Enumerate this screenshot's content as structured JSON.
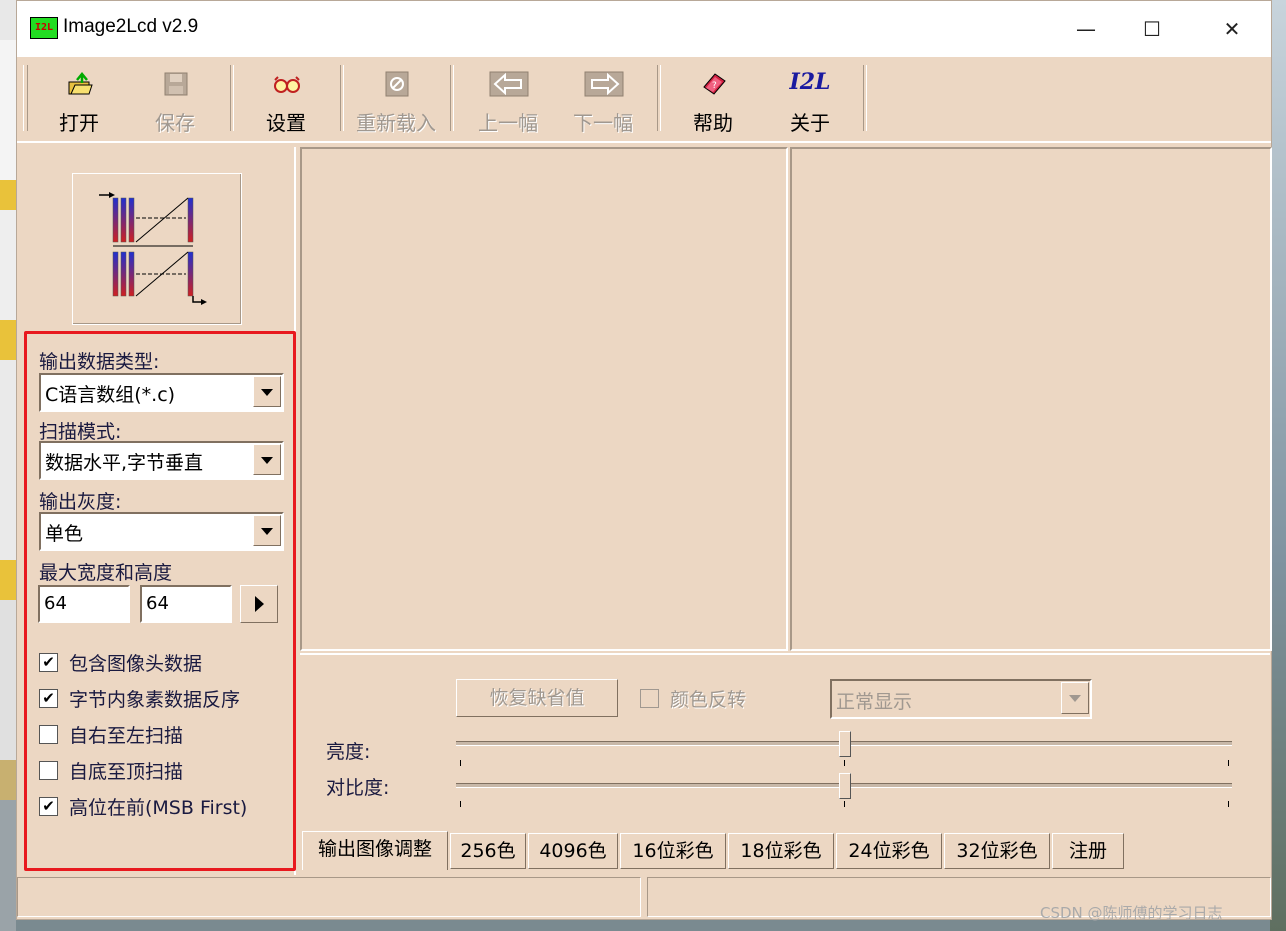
{
  "window": {
    "app_icon_text": "I2L",
    "title": "Image2Lcd v2.9",
    "controls": [
      "—",
      "☐",
      "✕"
    ]
  },
  "toolbar": {
    "open": "打开",
    "save": "保存",
    "settings": "设置",
    "reload": "重新载入",
    "prev": "上一幅",
    "next": "下一幅",
    "help": "帮助",
    "about": "关于",
    "about_icon_text": "I2L"
  },
  "left_panel": {
    "output_type_label": "输出数据类型:",
    "output_type_value": "C语言数组(*.c)",
    "scan_mode_label": "扫描模式:",
    "scan_mode_value": "数据水平,字节垂直",
    "gray_label": "输出灰度:",
    "gray_value": "单色",
    "max_size_label": "最大宽度和高度",
    "width_value": "64",
    "height_value": "64",
    "options": [
      {
        "label": "包含图像头数据",
        "checked": true
      },
      {
        "label": "字节内象素数据反序",
        "checked": true
      },
      {
        "label": "自右至左扫描",
        "checked": false
      },
      {
        "label": "自底至顶扫描",
        "checked": false
      },
      {
        "label": "高位在前(MSB First)",
        "checked": true
      }
    ]
  },
  "adjust": {
    "restore_button": "恢复缺省值",
    "invert_label": "颜色反转",
    "display_mode": "正常显示",
    "brightness_label": "亮度:",
    "contrast_label": "对比度:",
    "brightness_value": 0.5,
    "contrast_value": 0.5
  },
  "tabs": [
    "输出图像调整",
    "256色",
    "4096色",
    "16位彩色",
    "18位彩色",
    "24位彩色",
    "32位彩色",
    "注册"
  ],
  "watermark": "CSDN @陈师傅的学习日志"
}
